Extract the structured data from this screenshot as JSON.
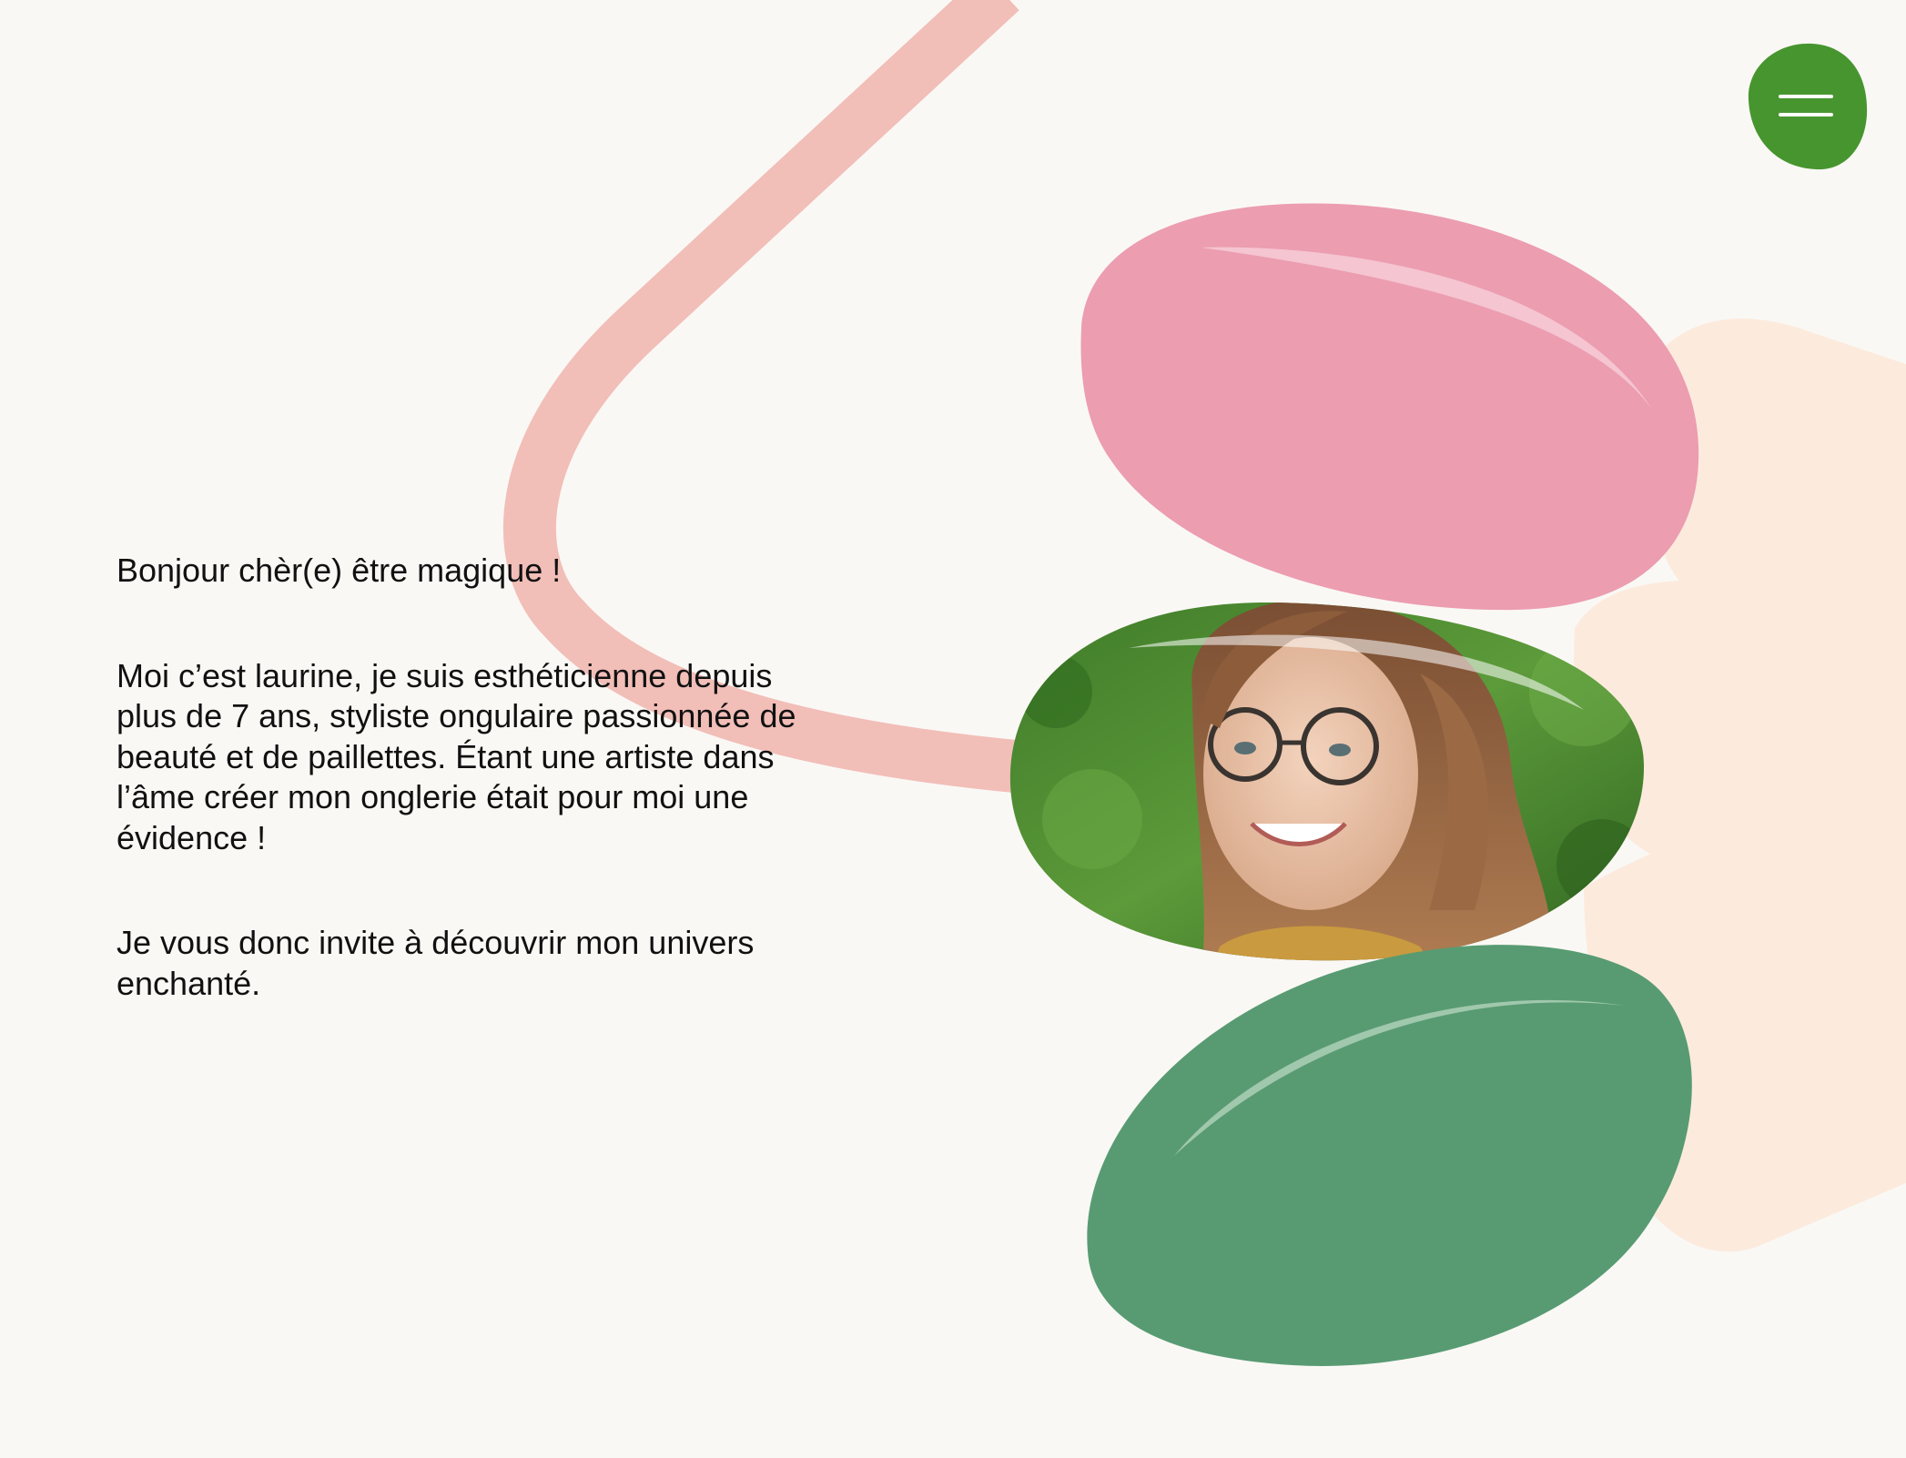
{
  "header": {
    "menu_button": "menu-icon"
  },
  "intro": {
    "greeting": "Bonjour chèr(e) être magique !",
    "bio": "Moi c’est laurine, je suis esthéticienne depuis plus de 7 ans, styliste ongulaire passionnée de beauté et de paillettes. Étant une artiste dans l’âme créer mon onglerie était pour moi une évidence !",
    "invitation": "Je vous donc invite à découvrir mon univers enchanté."
  },
  "colors": {
    "background": "#FAF8F5",
    "pink_nail": "#EC9DB0",
    "green_nail": "#589B72",
    "skin": "#FCEBDD",
    "ribbon": "#F2BEB8",
    "menu_button": "#47952F",
    "text": "#111111"
  }
}
